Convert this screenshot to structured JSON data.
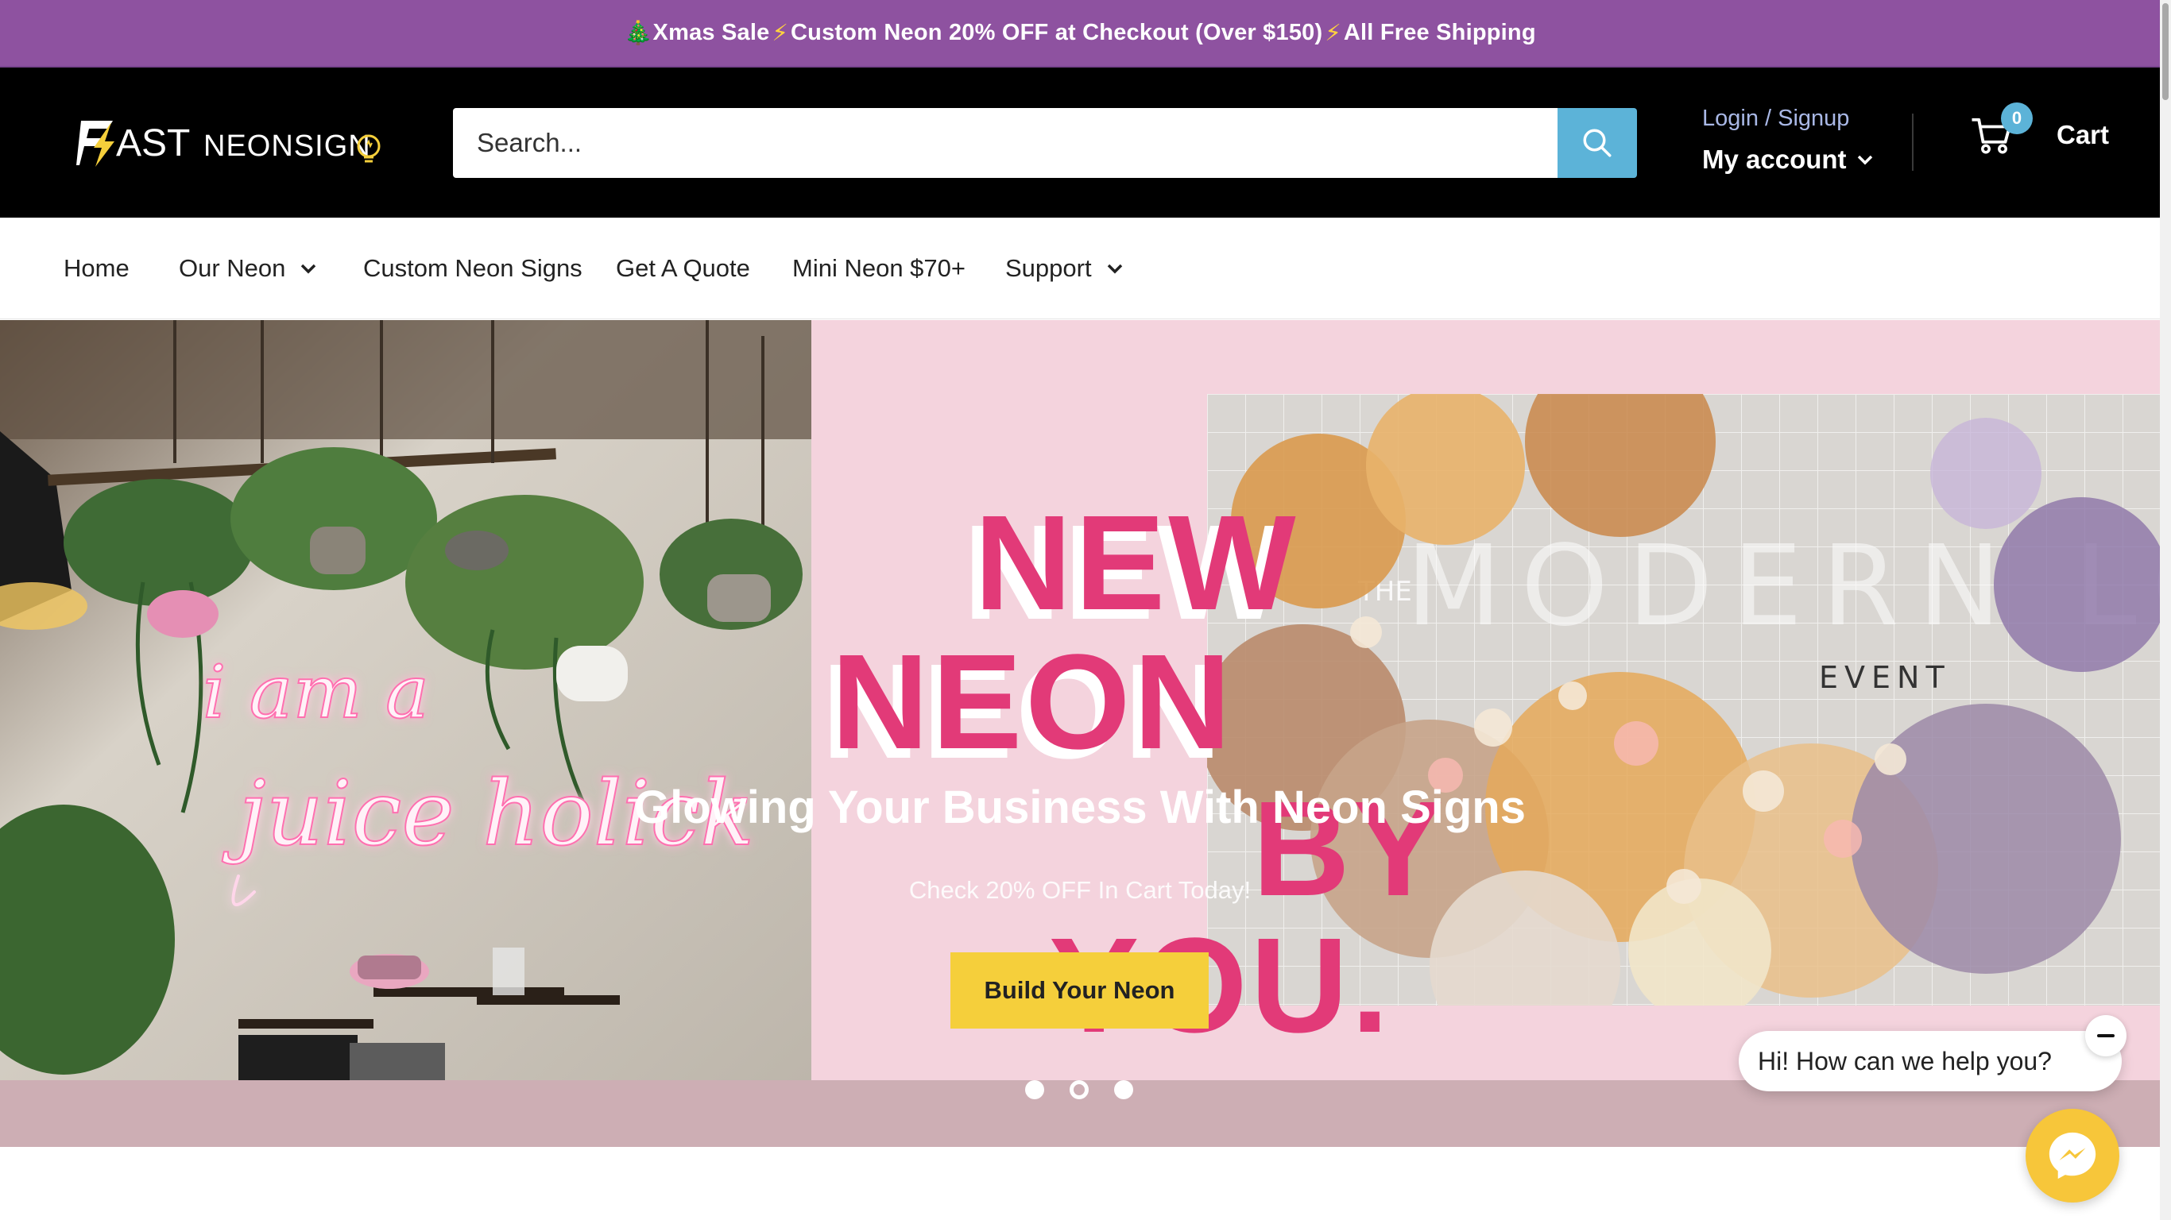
{
  "announcement": {
    "tree": "🎄",
    "part1": "Xmas Sale",
    "bolt": "⚡",
    "part2": "Custom Neon 20% OFF at Checkout (Over $150)",
    "part3": " All Free Shipping"
  },
  "header": {
    "logo_text": "FAST NEONSIGNO",
    "search_placeholder": "Search...",
    "login_label": "Login / Signup",
    "account_label": "My account",
    "cart_label": "Cart",
    "cart_count": "0"
  },
  "nav": {
    "items": [
      {
        "label": "Home",
        "dropdown": false
      },
      {
        "label": "Our Neon",
        "dropdown": true
      },
      {
        "label": "Custom Neon Signs",
        "dropdown": false
      },
      {
        "label": "Get A Quote",
        "dropdown": false
      },
      {
        "label": "Mini Neon $70+",
        "dropdown": false
      },
      {
        "label": "Support",
        "dropdown": true
      }
    ]
  },
  "hero": {
    "sign_line1": "i am a",
    "sign_line2": "juice holick",
    "graphic_words": [
      "NEW",
      "NEON",
      "BY",
      "YOU."
    ],
    "flower_sign": "MODERN LOVE",
    "flower_sign_the": "THE",
    "flower_sign_event": "EVENT",
    "heading": "Glowing Your Business With Neon Signs",
    "subheading": "Check 20% OFF In Cart Today!",
    "button_label": "Build Your Neon",
    "slides": 3,
    "active_slide": 2
  },
  "chat": {
    "message": "Hi! How can we help you?"
  },
  "colors": {
    "announcement_bg": "#8e52a0",
    "header_bg": "#000000",
    "accent_blue": "#5cb3d8",
    "button_yellow": "#f5cf3b",
    "neon_pink": "#e23a78"
  }
}
